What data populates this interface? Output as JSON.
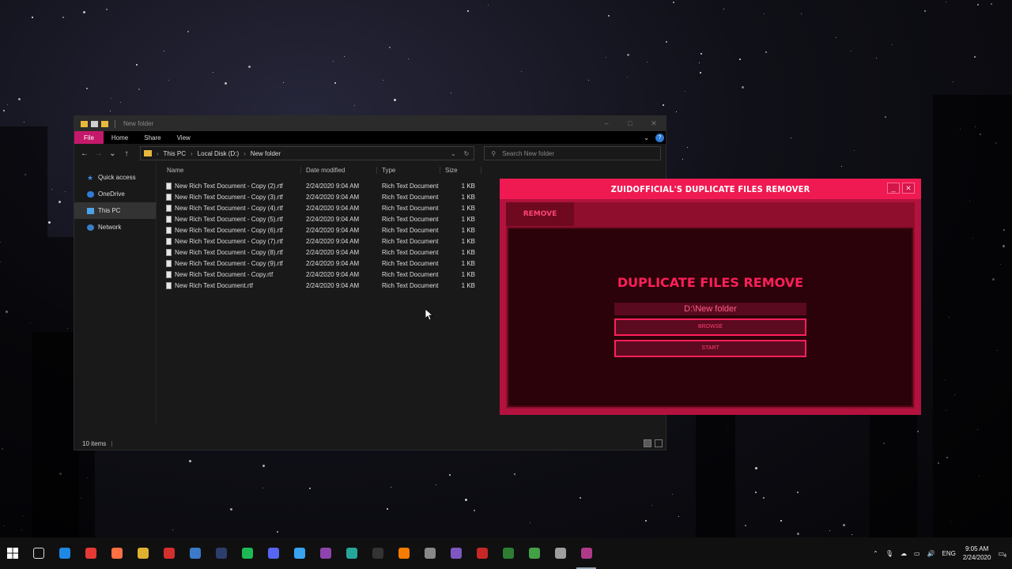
{
  "explorer": {
    "title": "New folder",
    "ribbon_tabs": [
      "File",
      "Home",
      "Share",
      "View"
    ],
    "breadcrumb": [
      "This PC",
      "Local Disk (D:)",
      "New folder"
    ],
    "search_placeholder": "Search New folder",
    "nav_pane": [
      "Quick access",
      "OneDrive",
      "This PC",
      "Network"
    ],
    "columns": {
      "name": "Name",
      "date": "Date modified",
      "type": "Type",
      "size": "Size"
    },
    "files": [
      {
        "name": "New Rich Text Document - Copy (2).rtf",
        "date": "2/24/2020 9:04 AM",
        "type": "Rich Text Document",
        "size": "1 KB"
      },
      {
        "name": "New Rich Text Document - Copy (3).rtf",
        "date": "2/24/2020 9:04 AM",
        "type": "Rich Text Document",
        "size": "1 KB"
      },
      {
        "name": "New Rich Text Document - Copy (4).rtf",
        "date": "2/24/2020 9:04 AM",
        "type": "Rich Text Document",
        "size": "1 KB"
      },
      {
        "name": "New Rich Text Document - Copy (5).rtf",
        "date": "2/24/2020 9:04 AM",
        "type": "Rich Text Document",
        "size": "1 KB"
      },
      {
        "name": "New Rich Text Document - Copy (6).rtf",
        "date": "2/24/2020 9:04 AM",
        "type": "Rich Text Document",
        "size": "1 KB"
      },
      {
        "name": "New Rich Text Document - Copy (7).rtf",
        "date": "2/24/2020 9:04 AM",
        "type": "Rich Text Document",
        "size": "1 KB"
      },
      {
        "name": "New Rich Text Document - Copy (8).rtf",
        "date": "2/24/2020 9:04 AM",
        "type": "Rich Text Document",
        "size": "1 KB"
      },
      {
        "name": "New Rich Text Document - Copy (9).rtf",
        "date": "2/24/2020 9:04 AM",
        "type": "Rich Text Document",
        "size": "1 KB"
      },
      {
        "name": "New Rich Text Document - Copy.rtf",
        "date": "2/24/2020 9:04 AM",
        "type": "Rich Text Document",
        "size": "1 KB"
      },
      {
        "name": "New Rich Text Document.rtf",
        "date": "2/24/2020 9:04 AM",
        "type": "Rich Text Document",
        "size": "1 KB"
      }
    ],
    "status": "10 items"
  },
  "app": {
    "title": "ZUIDOFFICIAL'S DUPLICATE FILES REMOVER",
    "tab": "REMOVE",
    "heading": "DUPLICATE FILES REMOVE",
    "path": "D:\\New folder",
    "browse_label": "BROWSE",
    "start_label": "START",
    "accent": "#f01a52"
  },
  "taskbar": {
    "lang": "ENG",
    "time": "9:05 AM",
    "date": "2/24/2020",
    "notifications": "4"
  }
}
